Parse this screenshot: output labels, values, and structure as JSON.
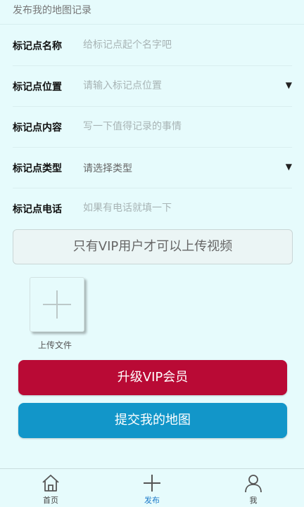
{
  "header": {
    "title": "发布我的地图记录"
  },
  "form": {
    "name": {
      "label": "标记点名称",
      "placeholder": "给标记点起个名字吧",
      "value": ""
    },
    "location": {
      "label": "标记点位置",
      "placeholder": "请输入标记点位置",
      "value": ""
    },
    "content": {
      "label": "标记点内容",
      "placeholder": "写一下值得记录的事情",
      "value": ""
    },
    "type": {
      "label": "标记点类型",
      "selected": "请选择类型"
    },
    "phone": {
      "label": "标记点电话",
      "placeholder": "如果有电话就填一下",
      "value": ""
    }
  },
  "vip_notice": "只有VIP用户才可以上传视频",
  "upload": {
    "label": "上传文件"
  },
  "buttons": {
    "upgrade_vip": "升级VIP会员",
    "submit": "提交我的地图"
  },
  "tabs": [
    {
      "label": "首页",
      "icon": "home-icon",
      "active": false
    },
    {
      "label": "发布",
      "icon": "plus-icon",
      "active": true
    },
    {
      "label": "我",
      "icon": "user-icon",
      "active": false
    }
  ],
  "colors": {
    "background": "#e6fbfc",
    "vip_button": "#b90a35",
    "submit_button": "#1296c9",
    "active_tab": "#1a78c8"
  }
}
